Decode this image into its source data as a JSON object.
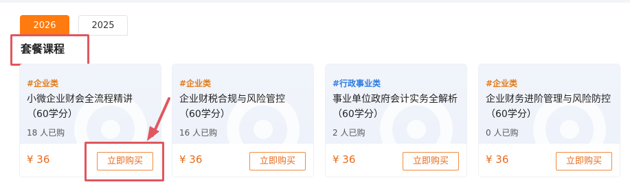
{
  "tabs": [
    {
      "label": "2026",
      "active": true
    },
    {
      "label": "2025",
      "active": false
    }
  ],
  "section_title": "套餐课程",
  "colors": {
    "accent": "#ff7a0f",
    "price": "#e86a1a",
    "annotation": "#e0565d",
    "tag_orange": "#e07b18",
    "tag_blue": "#2c7be0"
  },
  "courses": [
    {
      "tag": "#企业类",
      "tag_color": "orange",
      "title": "小微企业财会全流程精讲（60学分）",
      "buyers": "18 人已购",
      "price": "¥ 36",
      "buy_label": "立即购买"
    },
    {
      "tag": "#企业类",
      "tag_color": "orange",
      "title": "企业财税合规与风险管控（60学分）",
      "buyers": "16 人已购",
      "price": "¥ 36",
      "buy_label": "立即购买"
    },
    {
      "tag": "#行政事业类",
      "tag_color": "blue",
      "title": "事业单位政府会计实务全解析（60学分）",
      "buyers": "2 人已购",
      "price": "¥ 36",
      "buy_label": "立即购买"
    },
    {
      "tag": "#企业类",
      "tag_color": "orange",
      "title": "企业财务进阶管理与风险防控（60学分）",
      "buyers": "0 人已购",
      "price": "¥ 36",
      "buy_label": "立即购买"
    }
  ]
}
